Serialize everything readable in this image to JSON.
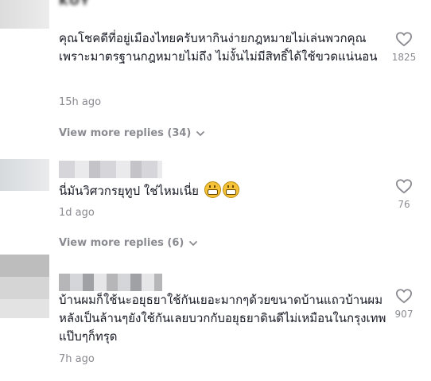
{
  "comments": [
    {
      "username": "KOY",
      "text": "คุณโชคดีที่อยู่เมืองไทยครับหากินง่ายกฎหมายไม่เล่นพวกคุณเพราะมาตรฐานกฎหมายไม่ถึง ไม่งั้นไม่มีสิทธิ์ได้ใช้ขวดแน่นอน",
      "time": "15h ago",
      "likes": "1825",
      "view_more": "View more replies (34)"
    },
    {
      "username": "",
      "text": "นี่มันวิศวกรยุทูป ใช่ไหมเนี่ย",
      "time": "1d ago",
      "likes": "76",
      "view_more": "View more replies (6)"
    },
    {
      "username": "Bl...",
      "text": "บ้านผมก็ใช้นะอยุธยาใช้กันเยอะมากๆด้วยขนาดบ้านแถวบ้านผมหลังเป็นล้านๆยังใช้กันเลยบวกกับอยุธยาดินดีไม่เหมือนในกรุงเทพแป๊บๆก็ทรุด",
      "time": "7h ago",
      "likes": "907"
    }
  ],
  "icons": {
    "like": "heart-outline-icon",
    "expand": "chevron-down-icon",
    "emoji": "grinning-face-icon"
  },
  "colors": {
    "text": "#161823",
    "muted": "#8a8b91",
    "background": "#ffffff"
  }
}
